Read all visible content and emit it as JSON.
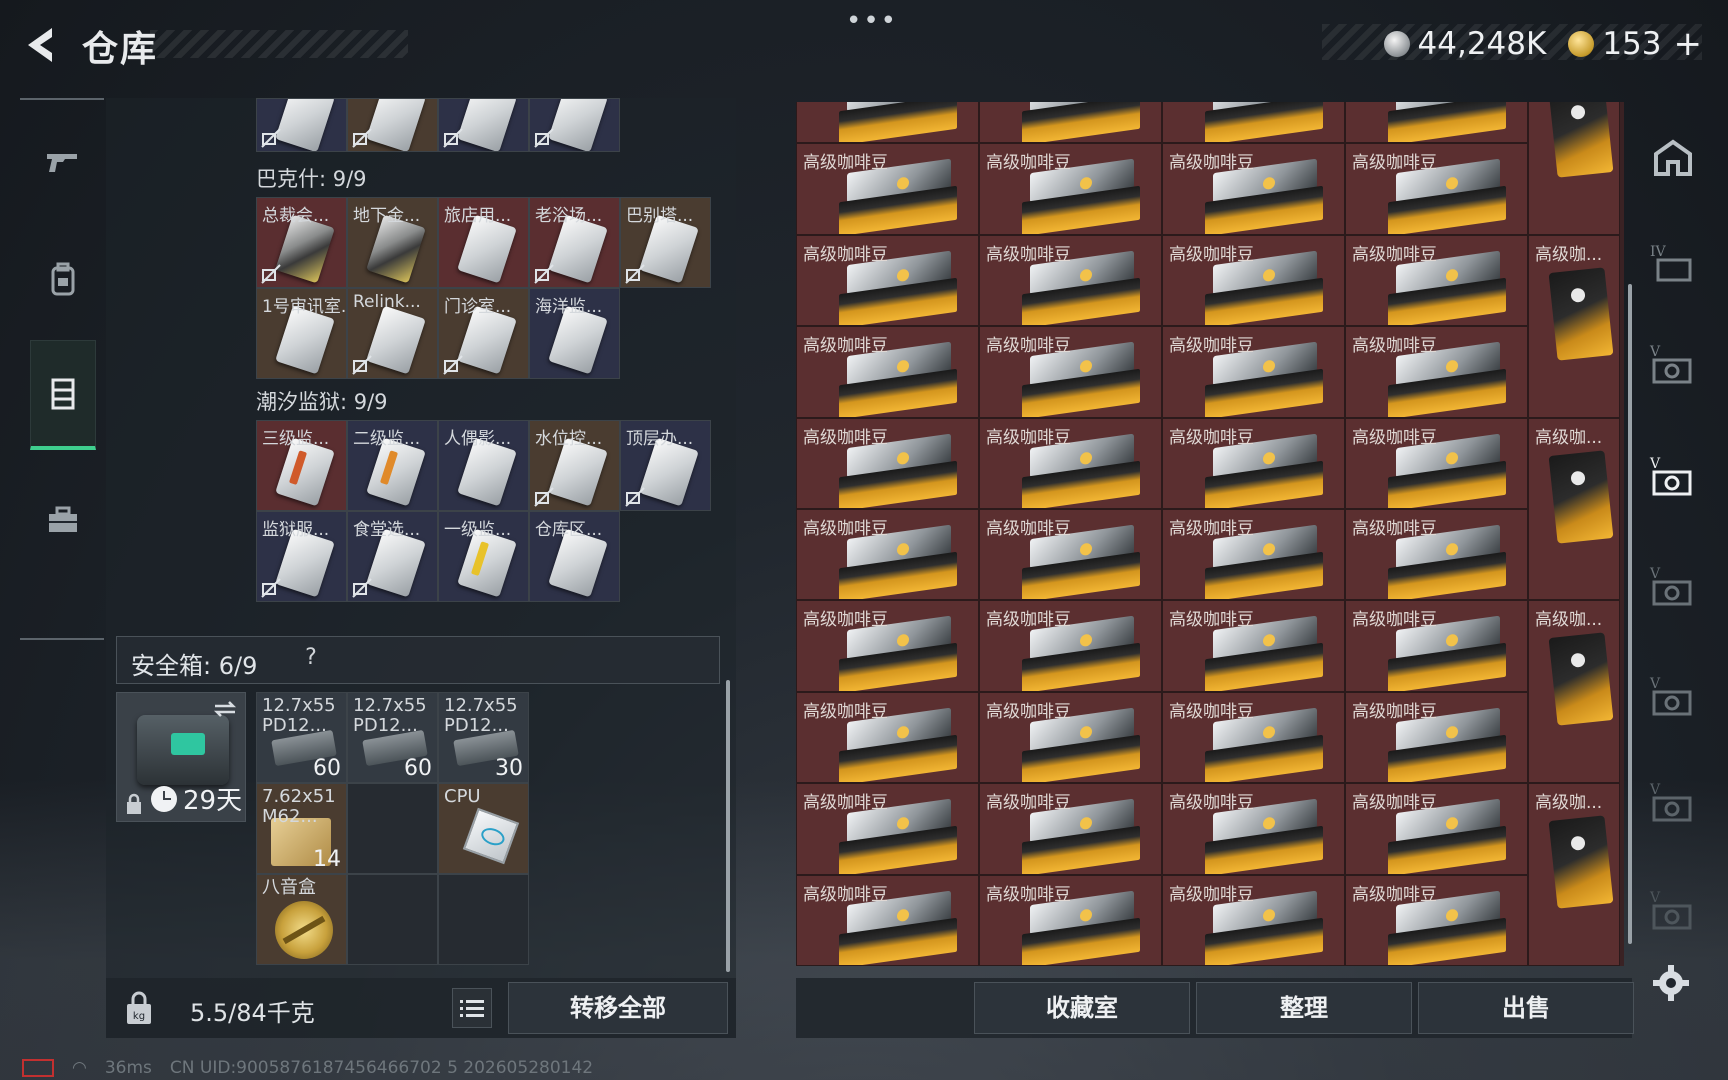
{
  "header": {
    "title": "仓库",
    "menu_dots": "•••",
    "currency_silver": "44,248K",
    "currency_gold": "153",
    "currency_plus": "+"
  },
  "left_nav": {
    "items": [
      "weapons",
      "backpack",
      "storage",
      "toolbox"
    ],
    "active": "storage"
  },
  "sections": {
    "top_row": [
      {
        "name": "",
        "color": "navy",
        "nodrop": true
      },
      {
        "name": "",
        "color": "brown",
        "nodrop": true
      },
      {
        "name": "",
        "color": "navy",
        "nodrop": true
      },
      {
        "name": "",
        "color": "navy",
        "nodrop": true
      }
    ],
    "bakeshi": {
      "label": "巴克什: 9/9",
      "items": [
        {
          "name": "总裁会...",
          "color": "red",
          "nodrop": true,
          "dark": true
        },
        {
          "name": "地下金...",
          "color": "brown",
          "nodrop": false,
          "dark": true
        },
        {
          "name": "旅店用...",
          "color": "red",
          "nodrop": false
        },
        {
          "name": "老浴场...",
          "color": "red",
          "nodrop": true
        },
        {
          "name": "巴别塔...",
          "color": "brown",
          "nodrop": true
        },
        {
          "name": "1号审讯室...",
          "color": "brown",
          "nodrop": false
        },
        {
          "name": "Relink...",
          "color": "brown",
          "nodrop": true
        },
        {
          "name": "门诊室...",
          "color": "brown",
          "nodrop": true
        },
        {
          "name": "海洋监...",
          "color": "navy",
          "nodrop": false
        }
      ]
    },
    "tide_prison": {
      "label": "潮汐监狱: 9/9",
      "items": [
        {
          "name": "三级监...",
          "color": "red",
          "nodrop": false,
          "stripe": "#d05a2a"
        },
        {
          "name": "二级监...",
          "color": "navy",
          "nodrop": false,
          "stripe": "#e08a2a"
        },
        {
          "name": "人偶影...",
          "color": "navy",
          "nodrop": false
        },
        {
          "name": "水位控...",
          "color": "brown",
          "nodrop": true
        },
        {
          "name": "顶层办...",
          "color": "navy",
          "nodrop": true
        },
        {
          "name": "监狱服...",
          "color": "navy",
          "nodrop": true
        },
        {
          "name": "食堂选...",
          "color": "navy",
          "nodrop": true
        },
        {
          "name": "一级监...",
          "color": "navy",
          "nodrop": false,
          "stripe": "#e8c22a"
        },
        {
          "name": "仓库区...",
          "color": "navy",
          "nodrop": false
        }
      ]
    }
  },
  "safe_box": {
    "label": "安全箱: 6/9",
    "help": "?",
    "days": "29天",
    "items": [
      {
        "name": "12.7x55 PD12...",
        "count": "60",
        "kind": "ammo"
      },
      {
        "name": "12.7x55 PD12...",
        "count": "60",
        "kind": "ammo"
      },
      {
        "name": "12.7x55 PD12...",
        "count": "30",
        "kind": "ammo"
      },
      {
        "name": "7.62x51 M62...",
        "count": "14",
        "kind": "box"
      },
      {
        "name": "",
        "count": "",
        "kind": "empty"
      },
      {
        "name": "CPU",
        "count": "",
        "kind": "cpu"
      },
      {
        "name": "八音盒",
        "count": "",
        "kind": "ring"
      },
      {
        "name": "",
        "count": "",
        "kind": "empty"
      },
      {
        "name": "",
        "count": "",
        "kind": "empty"
      }
    ]
  },
  "bottom_left": {
    "weight": "5.5/84千克",
    "transfer_all": "转移全部"
  },
  "right_panel": {
    "item_name": "高级咖啡豆",
    "tall_item_name": "高级咖...",
    "rows": 9
  },
  "bottom_right": {
    "collection": "收藏室",
    "organize": "整理",
    "sell": "出售"
  },
  "status": {
    "ping": "36ms",
    "uid": "CN UID:9005876187456466702 5 202605280142"
  },
  "colors": {
    "accent_green": "#3fcf8e",
    "rare_red": "#5b2f30"
  }
}
